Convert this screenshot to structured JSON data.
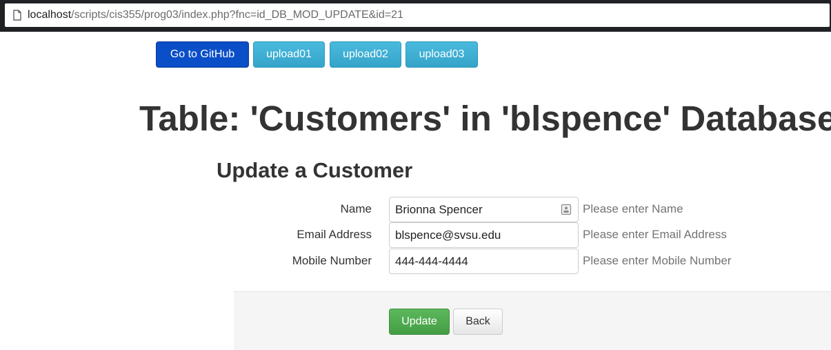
{
  "browser": {
    "url_host": "localhost",
    "url_path": "/scripts/cis355/prog03/index.php?fnc=id_DB_MOD_UPDATE&id=21"
  },
  "topnav": {
    "github": "Go to GitHub",
    "upload01": "upload01",
    "upload02": "upload02",
    "upload03": "upload03"
  },
  "page": {
    "title": "Table: 'Customers' in 'blspence' Database",
    "subtitle": "Update a Customer"
  },
  "form": {
    "name": {
      "label": "Name",
      "value": "Brionna Spencer",
      "help": "Please enter Name"
    },
    "email": {
      "label": "Email Address",
      "value": "blspence@svsu.edu",
      "help": "Please enter Email Address"
    },
    "mobile": {
      "label": "Mobile Number",
      "value": "444-444-4444",
      "help": "Please enter Mobile Number"
    },
    "update": "Update",
    "back": "Back"
  },
  "colors": {
    "primary": "#0a4ec8",
    "info": "#3fb0d3",
    "success": "#5cb85c"
  },
  "icons": {
    "page": "page-icon",
    "autofill": "contact-card-icon"
  }
}
